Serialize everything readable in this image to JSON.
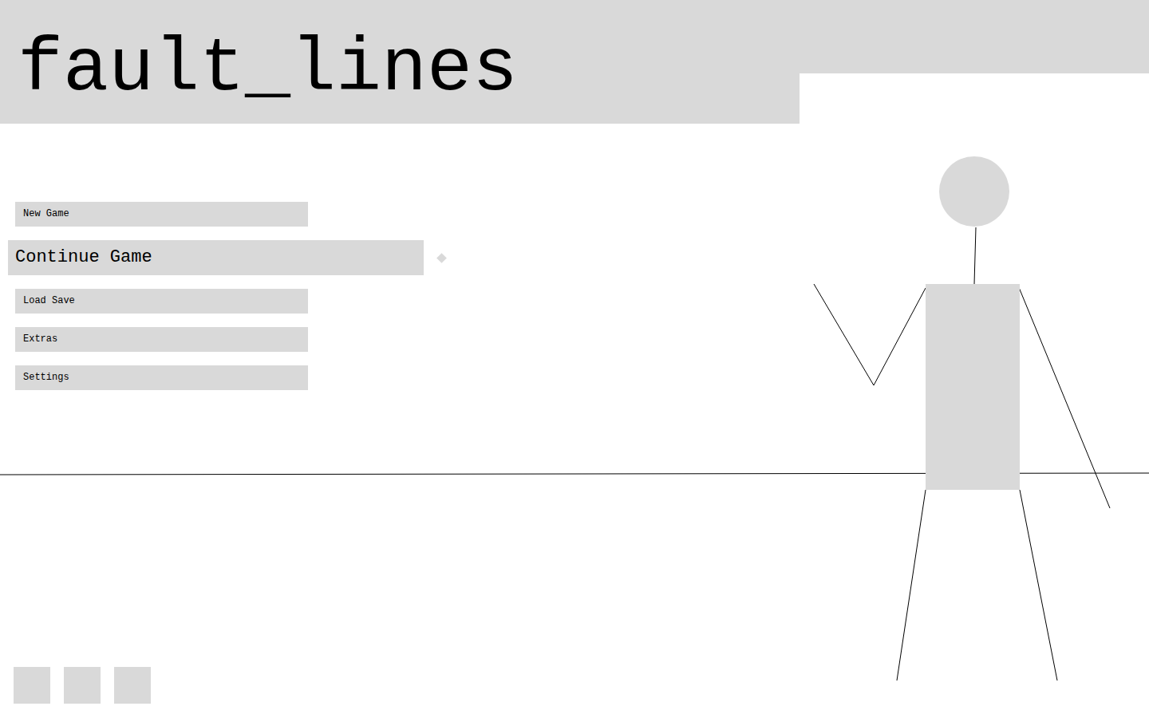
{
  "title": "fault_lines",
  "menu": [
    {
      "label": "New Game",
      "selected": false
    },
    {
      "label": "Continue Game",
      "selected": true
    },
    {
      "label": "Load Save",
      "selected": false
    },
    {
      "label": "Extras",
      "selected": false
    },
    {
      "label": "Settings",
      "selected": false
    }
  ]
}
